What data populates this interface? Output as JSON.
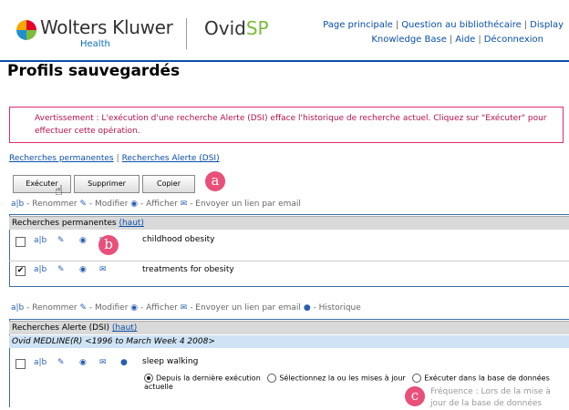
{
  "header": {
    "brand_primary": "Wolters Kluwer",
    "brand_sub": "Health",
    "product_ovid": "Ovid",
    "product_sp": "SP",
    "links_row1": [
      "Page principale",
      "Question au bibliothécaire",
      "Display"
    ],
    "links_row2": [
      "Knowledge Base",
      "Aide",
      "Déconnexion"
    ],
    "link_separator": "|"
  },
  "page_title": "Profils sauvegardés",
  "warning": "Avertissement : L'exécution d'une recherche Alerte (DSI) efface l'historique de recherche actuel. Cliquez sur \"Exécuter\" pour effectuer cette opération.",
  "tabs": [
    "Recherches permanentes",
    "Recherches Alerte (DSI)"
  ],
  "tab_separator": "|",
  "buttons": {
    "execute": "Exécuter",
    "delete": "Supprimer",
    "copy": "Copier"
  },
  "legend1": {
    "rename_glyph": "a|b",
    "rename": "- Renommer",
    "modify": "- Modifier",
    "display": "- Afficher",
    "email": "- Envoyer un lien par email"
  },
  "legend2": {
    "rename_glyph": "a|b",
    "rename": "- Renommer",
    "modify": "- Modifier",
    "display": "- Afficher",
    "email": "- Envoyer un lien par email",
    "history": "- Historique"
  },
  "permanent": {
    "heading": "Recherches permanentes",
    "top_link": "(haut)",
    "rows": [
      {
        "name": "childhood obesity",
        "checked": false
      },
      {
        "name": "treatments for obesity",
        "checked": true
      }
    ]
  },
  "alerts": {
    "heading": "Recherches Alerte (DSI)",
    "top_link": "(haut)",
    "database": "Ovid MEDLINE(R) <1996 to March Week 4 2008>",
    "row_name": "sleep walking",
    "row_checked": false,
    "options": [
      {
        "label": "Depuis la dernière exécution",
        "selected": true
      },
      {
        "label": "Sélectionnez la ou les mises à jour",
        "selected": false
      },
      {
        "label": "Exécuter dans la base de données actuelle",
        "selected": false
      }
    ],
    "frequency": "Fréquence : Lors de la mise à jour de la base de données"
  },
  "callouts": {
    "a": "a",
    "b": "b",
    "c": "c"
  },
  "colors": {
    "accent": "#0a4fa8",
    "warning": "#e22a72",
    "callout": "#e8507a",
    "section_header": "#d9d9d9",
    "database_bar": "#cfe3f5"
  }
}
